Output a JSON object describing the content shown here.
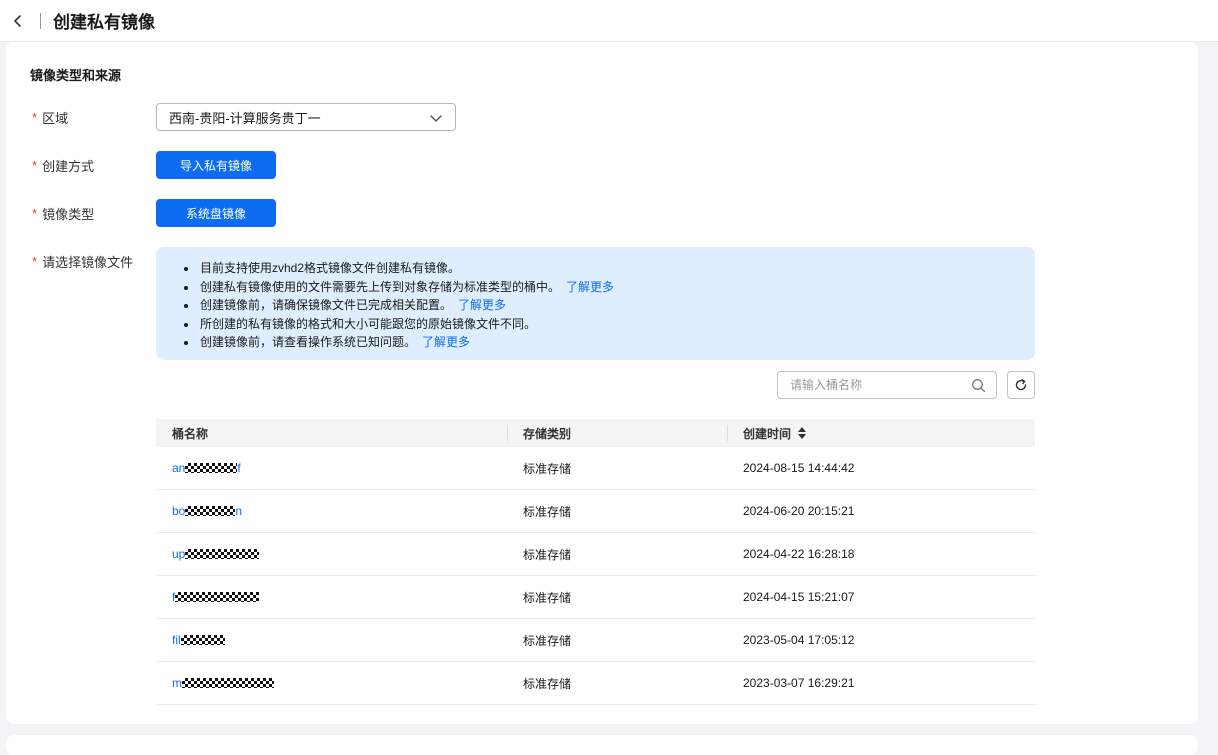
{
  "header": {
    "title": "创建私有镜像"
  },
  "section": {
    "title": "镜像类型和来源"
  },
  "form": {
    "region": {
      "label": "区域",
      "value": "西南-贵阳-计算服务贵丁一"
    },
    "create_method": {
      "label": "创建方式",
      "button": "导入私有镜像"
    },
    "image_type": {
      "label": "镜像类型",
      "button": "系统盘镜像"
    },
    "image_file": {
      "label": "请选择镜像文件"
    }
  },
  "tips": [
    {
      "text": "目前支持使用zvhd2格式镜像文件创建私有镜像。",
      "link": ""
    },
    {
      "text": "创建私有镜像使用的文件需要先上传到对象存储为标准类型的桶中。",
      "link": "了解更多"
    },
    {
      "text": "创建镜像前，请确保镜像文件已完成相关配置。",
      "link": "了解更多"
    },
    {
      "text": "所创建的私有镜像的格式和大小可能跟您的原始镜像文件不同。",
      "link": ""
    },
    {
      "text": "创建镜像前，请查看操作系统已知问题。",
      "link": "了解更多"
    }
  ],
  "search": {
    "placeholder": "请输入桶名称"
  },
  "table": {
    "headers": [
      "桶名称",
      "存储类别",
      "创建时间"
    ],
    "rows": [
      {
        "name": "an",
        "storage": "标准存储",
        "created": "2024-08-15 14:44:42"
      },
      {
        "name": "bo",
        "storage": "标准存储",
        "created": "2024-06-20 20:15:21"
      },
      {
        "name": "up",
        "storage": "标准存储",
        "created": "2024-04-22 16:28:18"
      },
      {
        "name": "f",
        "storage": "标准存储",
        "created": "2024-04-15 15:21:07"
      },
      {
        "name": "fil",
        "storage": "标准存储",
        "created": "2023-05-04 17:05:12"
      },
      {
        "name": "m",
        "storage": "标准存储",
        "created": "2023-03-07 16:29:21"
      }
    ]
  },
  "colors": {
    "primary": "#0d6df2",
    "required": "#e8373a",
    "tips_bg": "#dfeeff"
  }
}
